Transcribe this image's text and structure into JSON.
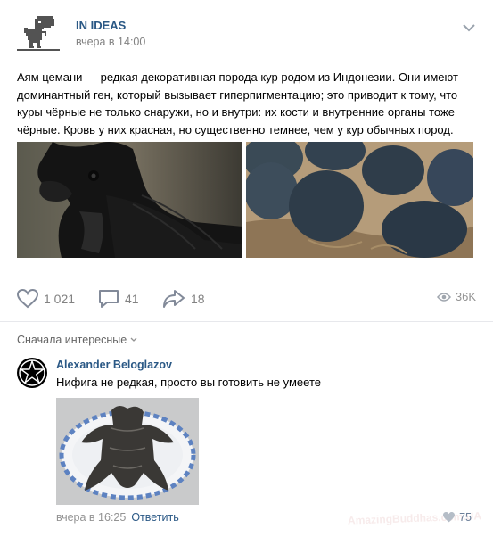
{
  "post": {
    "author": "IN IDEAS",
    "time": "вчера в 14:00",
    "text": "Аям цемани — редкая декоративная порода кур родом из Индонезии. Они имеют доминантный ген, который вызывает гиперпигментацию; это приводит к тому, что куры чёрные не только снаружи, но и внутри: их кости и внутренние органы тоже чёрные. Кровь у них красная, но существенно темнее, чем у кур обычных пород.",
    "likes": "1 021",
    "comments": "41",
    "shares": "18",
    "views": "36K"
  },
  "comments_section": {
    "sort_label": "Сначала интересные",
    "comment": {
      "author": "Alexander Beloglazov",
      "text": "Нифига не редкая, просто вы готовить не умеете",
      "time": "вчера в 16:25",
      "reply_label": "Ответить",
      "likes": "75"
    }
  },
  "watermark": "AmazingBuddhas.com.UA",
  "icons": {
    "avatar": "dino-icon",
    "menu": "chevron-down-icon",
    "like": "heart-icon",
    "comment": "speech-bubble-icon",
    "share": "share-arrow-icon",
    "views": "eye-icon",
    "comment_avatar": "star-icon"
  },
  "colors": {
    "link": "#2a5885",
    "muted": "#828282",
    "divider": "#e7e8ec"
  }
}
